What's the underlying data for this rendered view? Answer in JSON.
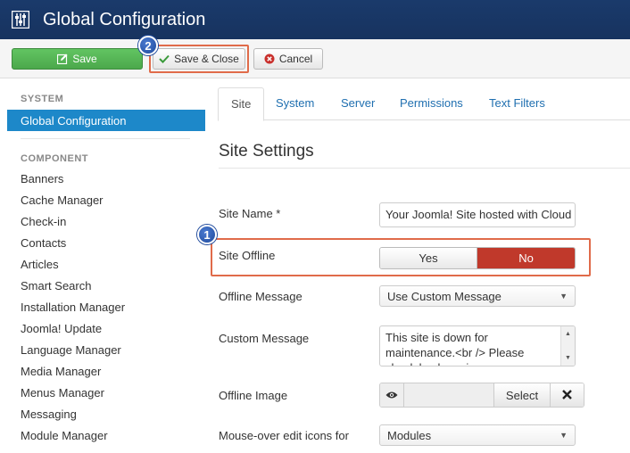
{
  "header": {
    "title": "Global Configuration",
    "icon": "equalizer-icon"
  },
  "toolbar": {
    "save_label": "Save",
    "save_close_label": "Save & Close",
    "cancel_label": "Cancel"
  },
  "callouts": {
    "first": "1",
    "second": "2"
  },
  "sidebar": {
    "system_heading": "SYSTEM",
    "active_item": "Global Configuration",
    "component_heading": "COMPONENT",
    "items": [
      "Banners",
      "Cache Manager",
      "Check-in",
      "Contacts",
      "Articles",
      "Smart Search",
      "Installation Manager",
      "Joomla! Update",
      "Language Manager",
      "Media Manager",
      "Menus Manager",
      "Messaging",
      "Module Manager"
    ]
  },
  "tabs": [
    "Site",
    "System",
    "Server",
    "Permissions",
    "Text Filters"
  ],
  "content": {
    "section_title": "Site Settings",
    "site_name_label": "Site Name *",
    "site_name_value": "Your Joomla! Site hosted with Cloud",
    "site_offline_label": "Site Offline",
    "toggle_yes": "Yes",
    "toggle_no": "No",
    "offline_message_label": "Offline Message",
    "offline_message_value": "Use Custom Message",
    "custom_message_label": "Custom Message",
    "custom_message_value": "This site is down for maintenance.<br /> Please check back again soon.",
    "offline_image_label": "Offline Image",
    "select_label": "Select",
    "mouseover_label": "Mouse-over edit icons for",
    "mouseover_value": "Modules"
  },
  "colors": {
    "header_bg": "#17335f",
    "save_green": "#4ca84c",
    "sidebar_active": "#1d88c9",
    "toggle_no_red": "#c0392b",
    "callout_outline": "#e06b4a",
    "link_blue": "#1f6fb0"
  }
}
